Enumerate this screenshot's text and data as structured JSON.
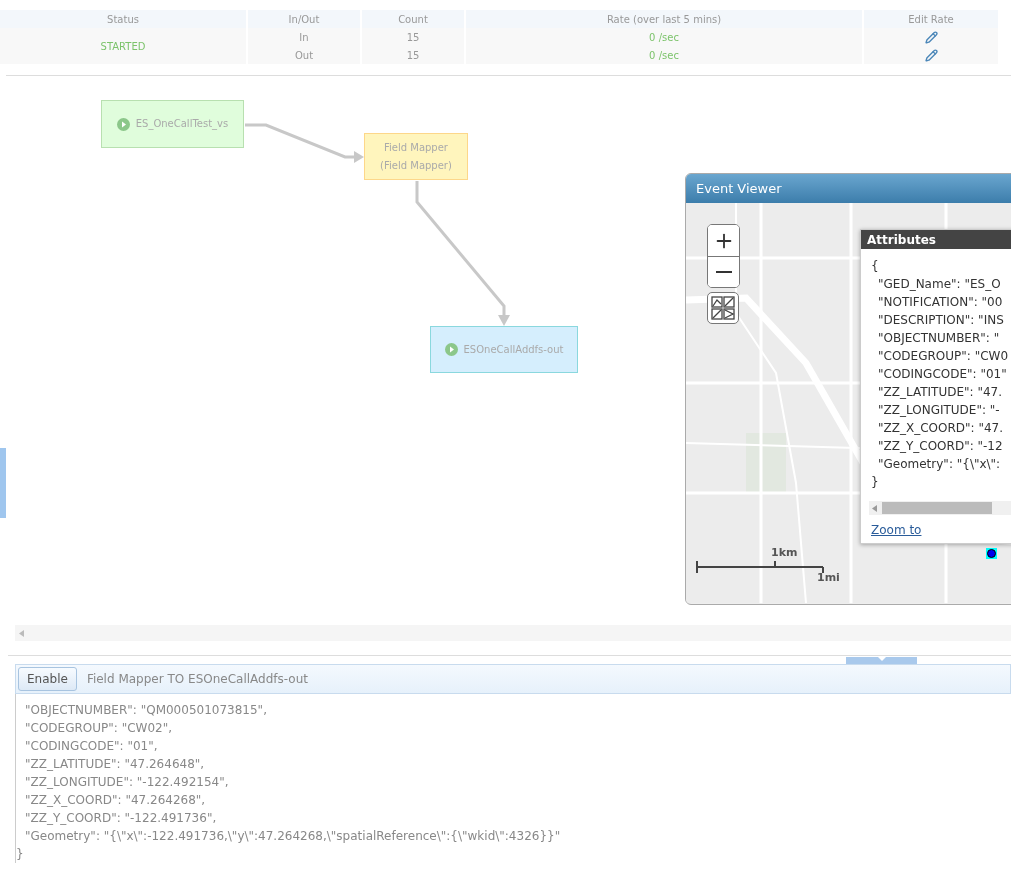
{
  "stats": {
    "columns": [
      "Status",
      "In/Out",
      "Count",
      "Rate (over last 5 mins)",
      "Edit Rate"
    ],
    "status": "STARTED",
    "rows": [
      {
        "in_out": "In",
        "count": "15",
        "rate": "0 /sec"
      },
      {
        "in_out": "Out",
        "count": "15",
        "rate": "0 /sec"
      }
    ]
  },
  "diagram": {
    "nodes": [
      {
        "kind": "source",
        "lines": [
          "ES_OneCallTest_vs"
        ]
      },
      {
        "kind": "processor",
        "lines": [
          "Field Mapper",
          "(Field Mapper)"
        ]
      },
      {
        "kind": "output",
        "lines": [
          "ESOneCallAddfs-out"
        ]
      }
    ]
  },
  "event_viewer": {
    "title": "Event Viewer",
    "scale": {
      "metric": "1km",
      "imperial": "1mi"
    },
    "popup": {
      "title": "Attributes",
      "open": "{",
      "lines": [
        "\"GED_Name\": \"ES_O",
        "\"NOTIFICATION\": \"00",
        "\"DESCRIPTION\": \"INS",
        "\"OBJECTNUMBER\": \"",
        "\"CODEGROUP\": \"CW0",
        "\"CODINGCODE\": \"01\"",
        "\"ZZ_LATITUDE\": \"47.",
        "\"ZZ_LONGITUDE\": \"-",
        "\"ZZ_X_COORD\": \"47.",
        "\"ZZ_Y_COORD\": \"-12",
        "\"Geometry\": \"{\\\"x\\\":"
      ],
      "close": "}",
      "link": "Zoom to"
    }
  },
  "log": {
    "button": "Enable",
    "title": "Field Mapper TO ESOneCallAddfs-out",
    "lines": [
      "\"OBJECTNUMBER\": \"QM000501073815\",",
      "\"CODEGROUP\": \"CW02\",",
      "\"CODINGCODE\": \"01\",",
      "\"ZZ_LATITUDE\": \"47.264648\",",
      "\"ZZ_LONGITUDE\": \"-122.492154\",",
      "\"ZZ_X_COORD\": \"47.264268\",",
      "\"ZZ_Y_COORD\": \"-122.491736\",",
      "\"Geometry\": \"{\\\"x\\\":-122.491736,\\\"y\\\":47.264268,\\\"spatialReference\\\":{\\\"wkid\\\":4326}}\""
    ],
    "close": "}"
  }
}
